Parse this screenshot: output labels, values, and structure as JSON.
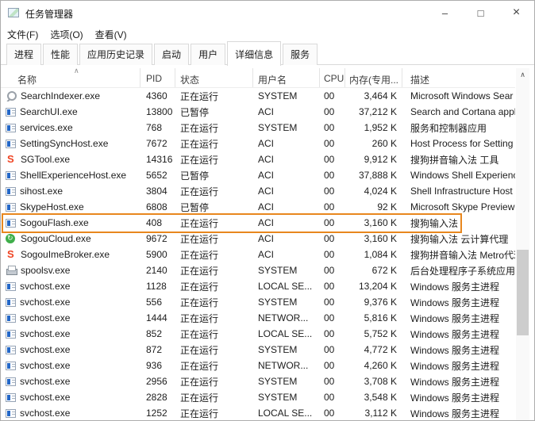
{
  "window": {
    "title": "任务管理器",
    "minimize_label": "–",
    "maximize_label": "□",
    "close_label": "×"
  },
  "menu_bar": {
    "items": [
      {
        "label": "文件(F)"
      },
      {
        "label": "选项(O)"
      },
      {
        "label": "查看(V)"
      }
    ]
  },
  "tab_bar": {
    "tabs": [
      {
        "label": "进程",
        "selected": false
      },
      {
        "label": "性能",
        "selected": false
      },
      {
        "label": "应用历史记录",
        "selected": false
      },
      {
        "label": "启动",
        "selected": false
      },
      {
        "label": "用户",
        "selected": false
      },
      {
        "label": "详细信息",
        "selected": true
      },
      {
        "label": "服务",
        "selected": false
      }
    ]
  },
  "details_table": {
    "columns": {
      "name": "名称",
      "pid": "PID",
      "status": "状态",
      "user": "用户名",
      "cpu": "CPU",
      "memory": "内存(专用...",
      "description": "描述"
    },
    "sort_indicator": "∧",
    "rows": [
      {
        "icon": "search",
        "name": "SearchIndexer.exe",
        "pid": "4360",
        "status": "正在运行",
        "user": "SYSTEM",
        "cpu": "00",
        "memory": "3,464 K",
        "description": "Microsoft Windows Sear",
        "state": ""
      },
      {
        "icon": "default",
        "name": "SearchUI.exe",
        "pid": "13800",
        "status": "已暂停",
        "user": "ACI",
        "cpu": "00",
        "memory": "37,212 K",
        "description": "Search and Cortana appl",
        "state": ""
      },
      {
        "icon": "default",
        "name": "services.exe",
        "pid": "768",
        "status": "正在运行",
        "user": "SYSTEM",
        "cpu": "00",
        "memory": "1,952 K",
        "description": "服务和控制器应用",
        "state": ""
      },
      {
        "icon": "default",
        "name": "SettingSyncHost.exe",
        "pid": "7672",
        "status": "正在运行",
        "user": "ACI",
        "cpu": "00",
        "memory": "260 K",
        "description": "Host Process for Setting",
        "state": ""
      },
      {
        "icon": "sogou-s",
        "name": "SGTool.exe",
        "pid": "14316",
        "status": "正在运行",
        "user": "ACI",
        "cpu": "00",
        "memory": "9,912 K",
        "description": "搜狗拼音输入法 工具",
        "state": ""
      },
      {
        "icon": "default",
        "name": "ShellExperienceHost.exe",
        "pid": "5652",
        "status": "已暂停",
        "user": "ACI",
        "cpu": "00",
        "memory": "37,888 K",
        "description": "Windows Shell Experienc",
        "state": ""
      },
      {
        "icon": "default",
        "name": "sihost.exe",
        "pid": "3804",
        "status": "正在运行",
        "user": "ACI",
        "cpu": "00",
        "memory": "4,024 K",
        "description": "Shell Infrastructure Host",
        "state": ""
      },
      {
        "icon": "default",
        "name": "SkypeHost.exe",
        "pid": "6808",
        "status": "已暂停",
        "user": "ACI",
        "cpu": "00",
        "memory": "92 K",
        "description": "Microsoft Skype Preview",
        "state": ""
      },
      {
        "icon": "default",
        "name": "SogouFlash.exe",
        "pid": "408",
        "status": "正在运行",
        "user": "ACI",
        "cpu": "00",
        "memory": "3,160 K",
        "description": "搜狗输入法",
        "state": "highlighted"
      },
      {
        "icon": "sogou-cloud",
        "name": "SogouCloud.exe",
        "pid": "9672",
        "status": "正在运行",
        "user": "ACI",
        "cpu": "00",
        "memory": "3,160 K",
        "description": "搜狗输入法 云计算代理",
        "state": ""
      },
      {
        "icon": "sogou-s",
        "name": "SogouImeBroker.exe",
        "pid": "5900",
        "status": "正在运行",
        "user": "ACI",
        "cpu": "00",
        "memory": "1,084 K",
        "description": "搜狗拼音输入法 Metro代理",
        "state": ""
      },
      {
        "icon": "printer",
        "name": "spoolsv.exe",
        "pid": "2140",
        "status": "正在运行",
        "user": "SYSTEM",
        "cpu": "00",
        "memory": "672 K",
        "description": "后台处理程序子系统应用",
        "state": ""
      },
      {
        "icon": "default",
        "name": "svchost.exe",
        "pid": "1128",
        "status": "正在运行",
        "user": "LOCAL SE...",
        "cpu": "00",
        "memory": "13,204 K",
        "description": "Windows 服务主进程",
        "state": ""
      },
      {
        "icon": "default",
        "name": "svchost.exe",
        "pid": "556",
        "status": "正在运行",
        "user": "SYSTEM",
        "cpu": "00",
        "memory": "9,376 K",
        "description": "Windows 服务主进程",
        "state": ""
      },
      {
        "icon": "default",
        "name": "svchost.exe",
        "pid": "1444",
        "status": "正在运行",
        "user": "NETWOR...",
        "cpu": "00",
        "memory": "5,816 K",
        "description": "Windows 服务主进程",
        "state": ""
      },
      {
        "icon": "default",
        "name": "svchost.exe",
        "pid": "852",
        "status": "正在运行",
        "user": "LOCAL SE...",
        "cpu": "00",
        "memory": "5,752 K",
        "description": "Windows 服务主进程",
        "state": ""
      },
      {
        "icon": "default",
        "name": "svchost.exe",
        "pid": "872",
        "status": "正在运行",
        "user": "SYSTEM",
        "cpu": "00",
        "memory": "4,772 K",
        "description": "Windows 服务主进程",
        "state": ""
      },
      {
        "icon": "default",
        "name": "svchost.exe",
        "pid": "936",
        "status": "正在运行",
        "user": "NETWOR...",
        "cpu": "00",
        "memory": "4,260 K",
        "description": "Windows 服务主进程",
        "state": ""
      },
      {
        "icon": "default",
        "name": "svchost.exe",
        "pid": "2956",
        "status": "正在运行",
        "user": "SYSTEM",
        "cpu": "00",
        "memory": "3,708 K",
        "description": "Windows 服务主进程",
        "state": ""
      },
      {
        "icon": "default",
        "name": "svchost.exe",
        "pid": "2828",
        "status": "正在运行",
        "user": "SYSTEM",
        "cpu": "00",
        "memory": "3,548 K",
        "description": "Windows 服务主进程",
        "state": ""
      },
      {
        "icon": "default",
        "name": "svchost.exe",
        "pid": "1252",
        "status": "正在运行",
        "user": "LOCAL SE...",
        "cpu": "00",
        "memory": "3,112 K",
        "description": "Windows 服务主进程",
        "state": ""
      }
    ]
  },
  "highlight": {
    "row": "SogouFlash.exe",
    "color": "#E8871E"
  },
  "scrollbar": {
    "up_arrow": "∧"
  }
}
